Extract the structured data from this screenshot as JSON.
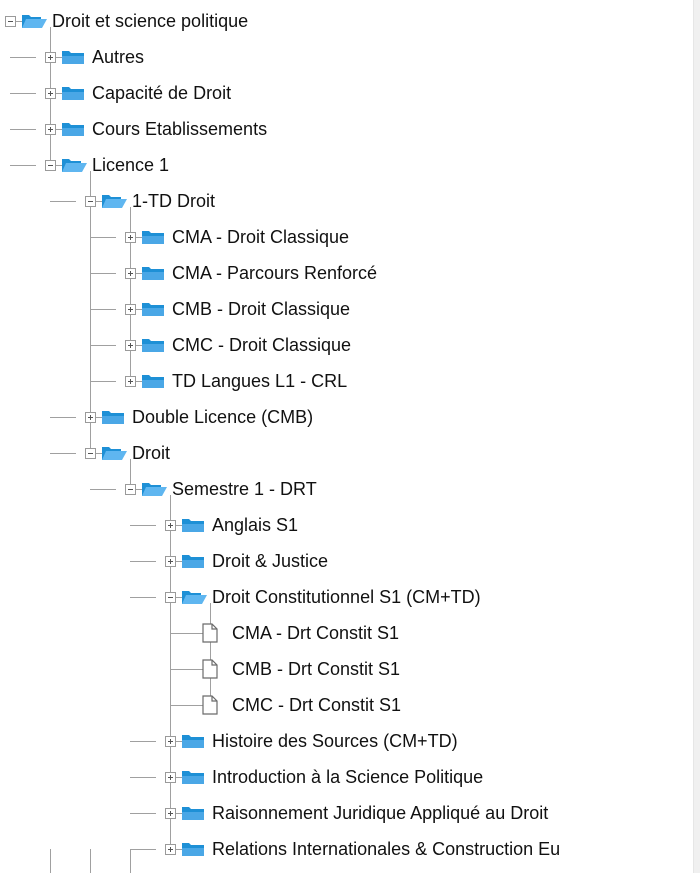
{
  "tree": [
    {
      "label": "Droit et science politique",
      "level": 0,
      "type": "folder",
      "expanded": true
    },
    {
      "label": "Autres",
      "level": 1,
      "type": "folder",
      "expanded": false
    },
    {
      "label": "Capacité de Droit",
      "level": 1,
      "type": "folder",
      "expanded": false
    },
    {
      "label": "Cours Etablissements",
      "level": 1,
      "type": "folder",
      "expanded": false
    },
    {
      "label": "Licence 1",
      "level": 1,
      "type": "folder",
      "expanded": true
    },
    {
      "label": "1-TD Droit",
      "level": 2,
      "type": "folder",
      "expanded": true
    },
    {
      "label": "CMA - Droit Classique",
      "level": 3,
      "type": "folder",
      "expanded": false
    },
    {
      "label": "CMA - Parcours Renforcé",
      "level": 3,
      "type": "folder",
      "expanded": false
    },
    {
      "label": "CMB - Droit Classique",
      "level": 3,
      "type": "folder",
      "expanded": false
    },
    {
      "label": "CMC - Droit Classique",
      "level": 3,
      "type": "folder",
      "expanded": false
    },
    {
      "label": "TD Langues L1 - CRL",
      "level": 3,
      "type": "folder",
      "expanded": false
    },
    {
      "label": "Double Licence (CMB)",
      "level": 2,
      "type": "folder",
      "expanded": false
    },
    {
      "label": "Droit",
      "level": 2,
      "type": "folder",
      "expanded": true
    },
    {
      "label": "Semestre 1 - DRT",
      "level": 3,
      "type": "folder",
      "expanded": true
    },
    {
      "label": "Anglais S1",
      "level": 4,
      "type": "folder",
      "expanded": false
    },
    {
      "label": "Droit & Justice",
      "level": 4,
      "type": "folder",
      "expanded": false
    },
    {
      "label": "Droit Constitutionnel S1 (CM+TD)",
      "level": 4,
      "type": "folder",
      "expanded": true
    },
    {
      "label": "CMA - Drt Constit S1",
      "level": 5,
      "type": "file"
    },
    {
      "label": "CMB - Drt Constit S1",
      "level": 5,
      "type": "file"
    },
    {
      "label": "CMC - Drt Constit S1",
      "level": 5,
      "type": "file"
    },
    {
      "label": "Histoire des Sources (CM+TD)",
      "level": 4,
      "type": "folder",
      "expanded": false
    },
    {
      "label": "Introduction à la Science Politique",
      "level": 4,
      "type": "folder",
      "expanded": false
    },
    {
      "label": "Raisonnement Juridique Appliqué au Droit",
      "level": 4,
      "type": "folder",
      "expanded": false
    },
    {
      "label": "Relations Internationales & Construction Eu",
      "level": 4,
      "type": "folder",
      "expanded": false
    }
  ],
  "colors": {
    "folder_body": "#1e90d6",
    "folder_tab": "#4aa7e6",
    "folder_open_front": "#5fb6f0",
    "file_stroke": "#6b6b6b"
  },
  "icons": {
    "folder_closed": "folder-icon",
    "folder_open": "folder-open-icon",
    "file": "file-icon",
    "expand": "plus-expander-icon",
    "collapse": "minus-expander-icon"
  }
}
